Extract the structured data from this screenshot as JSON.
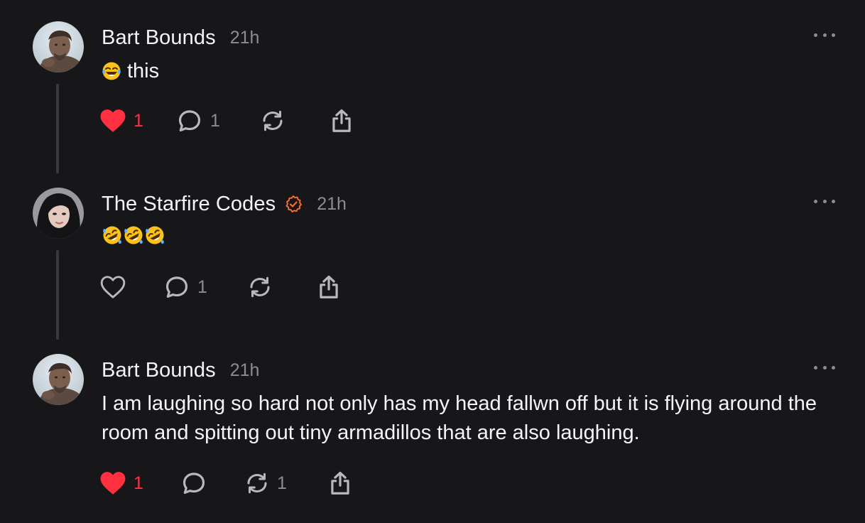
{
  "colors": {
    "background": "#17171a",
    "primary_text": "#f3f5f7",
    "secondary_text": "#8a8d91",
    "like_red": "#ff3040",
    "verified_orange": "#f56c2d",
    "thread_line": "#3a3a3d"
  },
  "posts": [
    {
      "username": "Bart Bounds",
      "timestamp": "21h",
      "verified": false,
      "avatar": "avatar-neanderthal-photo",
      "emoji": [
        "face-with-tears-of-joy-emoji"
      ],
      "text": "this",
      "liked": true,
      "likes": "1",
      "replies": "1",
      "reposts": "",
      "icons": [
        "heart-icon",
        "comment-icon",
        "repost-icon",
        "share-icon",
        "more-icon"
      ]
    },
    {
      "username": "The Starfire Codes",
      "timestamp": "21h",
      "verified": true,
      "avatar": "avatar-woman-photo",
      "emoji": [
        "rolling-on-floor-laughing-emoji",
        "rolling-on-floor-laughing-emoji",
        "rolling-on-floor-laughing-emoji"
      ],
      "text": "",
      "liked": false,
      "likes": "",
      "replies": "1",
      "reposts": "",
      "icons": [
        "heart-outline-icon",
        "comment-icon",
        "repost-icon",
        "share-icon",
        "more-icon"
      ]
    },
    {
      "username": "Bart Bounds",
      "timestamp": "21h",
      "verified": false,
      "avatar": "avatar-neanderthal-photo",
      "emoji": [],
      "text": "I am laughing so hard not only has my head fallwn off but it is flying around the room and spitting out tiny armadillos that are also laughing.",
      "liked": true,
      "likes": "1",
      "replies": "",
      "reposts": "1",
      "icons": [
        "heart-icon",
        "comment-icon",
        "repost-icon",
        "share-icon",
        "more-icon"
      ]
    }
  ]
}
